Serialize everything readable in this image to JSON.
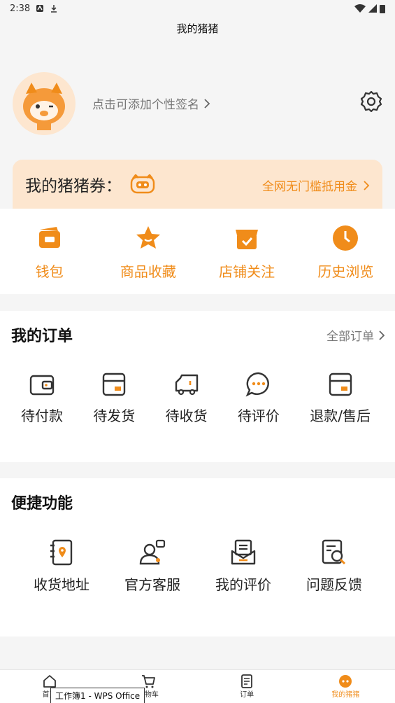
{
  "statusbar": {
    "time": "2:38"
  },
  "header": {
    "title": "我的猪猪"
  },
  "profile": {
    "signature": "点击可添加个性签名"
  },
  "coupon": {
    "label": "我的猪猪券：",
    "promo": "全网无门槛抵用金"
  },
  "quick": [
    {
      "label": "钱包",
      "icon": "wallet-icon"
    },
    {
      "label": "商品收藏",
      "icon": "star-icon"
    },
    {
      "label": "店铺关注",
      "icon": "store-icon"
    },
    {
      "label": "历史浏览",
      "icon": "clock-icon"
    }
  ],
  "orders": {
    "title": "我的订单",
    "more": "全部订单",
    "items": [
      {
        "label": "待付款"
      },
      {
        "label": "待发货"
      },
      {
        "label": "待收货"
      },
      {
        "label": "待评价"
      },
      {
        "label": "退款/售后"
      }
    ]
  },
  "tools": {
    "title": "便捷功能",
    "items": [
      {
        "label": "收货地址"
      },
      {
        "label": "官方客服"
      },
      {
        "label": "我的评价"
      },
      {
        "label": "问题反馈"
      }
    ]
  },
  "tabbar": [
    {
      "label": "首页"
    },
    {
      "label": "购物车"
    },
    {
      "label": "订单"
    },
    {
      "label": "我的猪猪"
    }
  ],
  "tooltip": "工作簿1 - WPS Office",
  "colors": {
    "accent": "#f08c1a",
    "coupon_bg": "#fde6cf"
  }
}
